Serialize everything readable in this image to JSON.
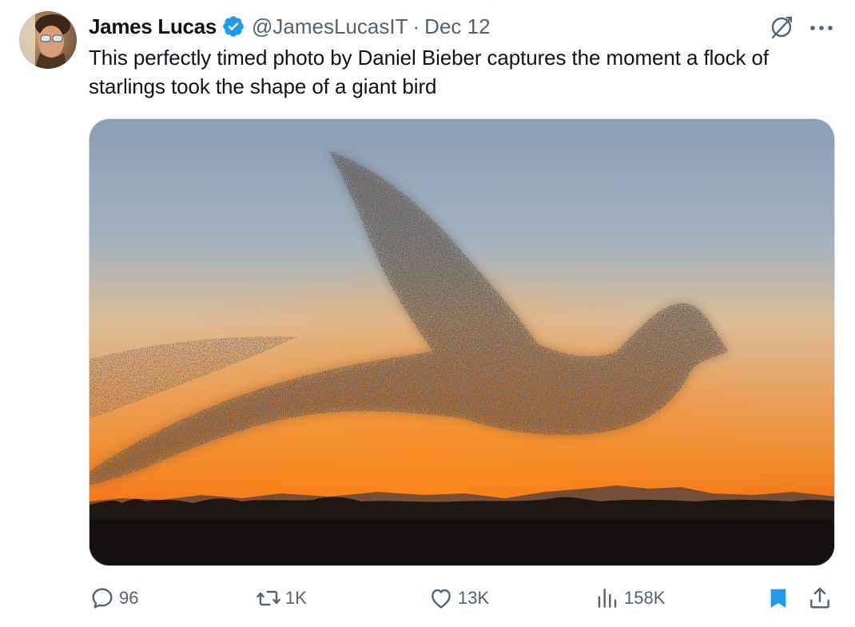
{
  "tweet": {
    "author_name": "James Lucas",
    "handle": "@JamesLucasIT",
    "separator": "·",
    "date": "Dec 12",
    "text": "This perfectly timed photo by Daniel Bieber captures the moment a flock of starlings took the shape of a giant bird",
    "verified": true
  },
  "media": {
    "type": "photo"
  },
  "actions": {
    "replies": "96",
    "reposts": "1K",
    "likes": "13K",
    "views": "158K"
  },
  "icons": {
    "verified": "verified-badge-icon",
    "grok": "grok-icon",
    "more": "more-icon",
    "reply": "reply-icon",
    "repost": "repost-icon",
    "like": "like-icon",
    "views": "views-icon",
    "bookmark": "bookmark-icon",
    "share": "share-icon"
  },
  "colors": {
    "text": "#0f1419",
    "secondary": "#536471",
    "accent": "#1d9bf0"
  }
}
